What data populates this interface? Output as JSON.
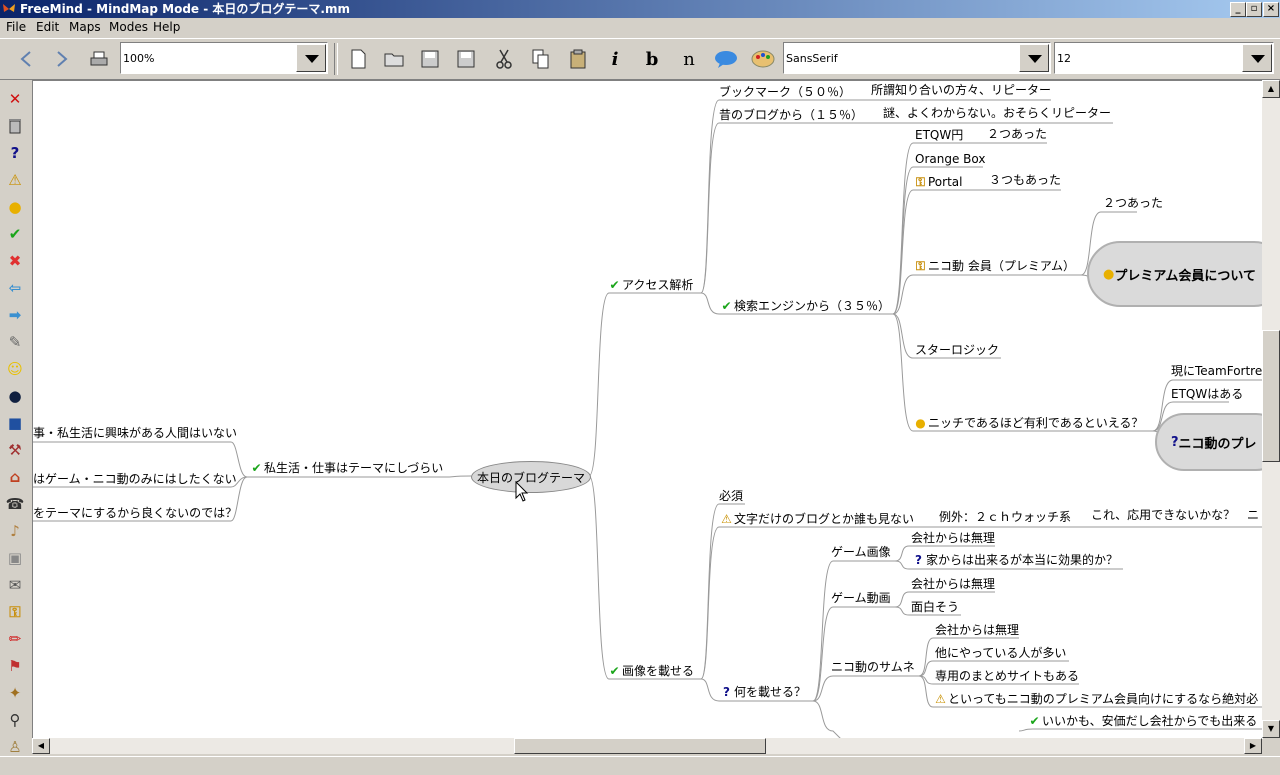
{
  "window": {
    "title": "FreeMind - MindMap Mode - 本日のブログテーマ.mm",
    "controls": [
      "_",
      "▫",
      "×"
    ]
  },
  "menu": [
    "File",
    "Edit",
    "Maps",
    "Modes",
    "Help"
  ],
  "toolbar": {
    "zoom": "100%",
    "font": "SansSerif",
    "size": "12",
    "italic_label": "i",
    "bold_label": "b",
    "normal_label": "n"
  },
  "mindmap": {
    "root": "本日のブログテーマ",
    "left": {
      "branch": "私生活・仕事はテーマにしづらい",
      "children": [
        "事・私生活に興味がある人間はいない",
        "はゲーム・ニコ動のみにはしたくない",
        "をテーマにするから良くないのでは？"
      ]
    },
    "access": {
      "label": "アクセス解析",
      "bookmark": "ブックマーク（５０％）",
      "bookmark_note": "所謂知り合いの方々、リピーター",
      "old_blog": "昔のブログから（１５％）",
      "old_blog_note": "謎、よくわからない。おそらくリピーター",
      "search": "検索エンジンから（３５％）",
      "etqw": "ETQW円",
      "etqw_note": "２つあった",
      "orange": "Orange Box",
      "portal": "Portal",
      "portal_note": "３つもあった",
      "nico": "ニコ動 会員（プレミアム）",
      "nico_note": "２つあった",
      "premium_cloud": "プレミアム会員について",
      "starlogic": "スターロジック",
      "niche": "ニッチであるほど有利であるといえる？",
      "tf": "現にTeamFortress",
      "etqw_exists": "ETQWはある",
      "nico_cloud": "ニコ動のプレ"
    },
    "images": {
      "label": "画像を載せる",
      "required": "必須",
      "text_only": "文字だけのブログとか誰も見ない",
      "exception": "例外：２ｃｈウォッチ系",
      "apply": "これ、応用できないかな？",
      "apply_tail": "ニ",
      "what": "何を載せる？",
      "game_image": "ゲーム画像",
      "gi_company": "会社からは無理",
      "gi_home": "家からは出来るが本当に効果的か？",
      "game_video": "ゲーム動画",
      "gv_company": "会社からは無理",
      "gv_fun": "面白そう",
      "nico_thumb": "ニコ動のサムネ",
      "nt_company": "会社からは無理",
      "nt_others": "他にやっている人が多い",
      "nt_sites": "専用のまとめサイトもある",
      "nt_premium": "といってもニコ動のプレミアム会員向けにするなら絶対必",
      "cheap": "いいかも、安価だし会社からでも出来る"
    }
  }
}
